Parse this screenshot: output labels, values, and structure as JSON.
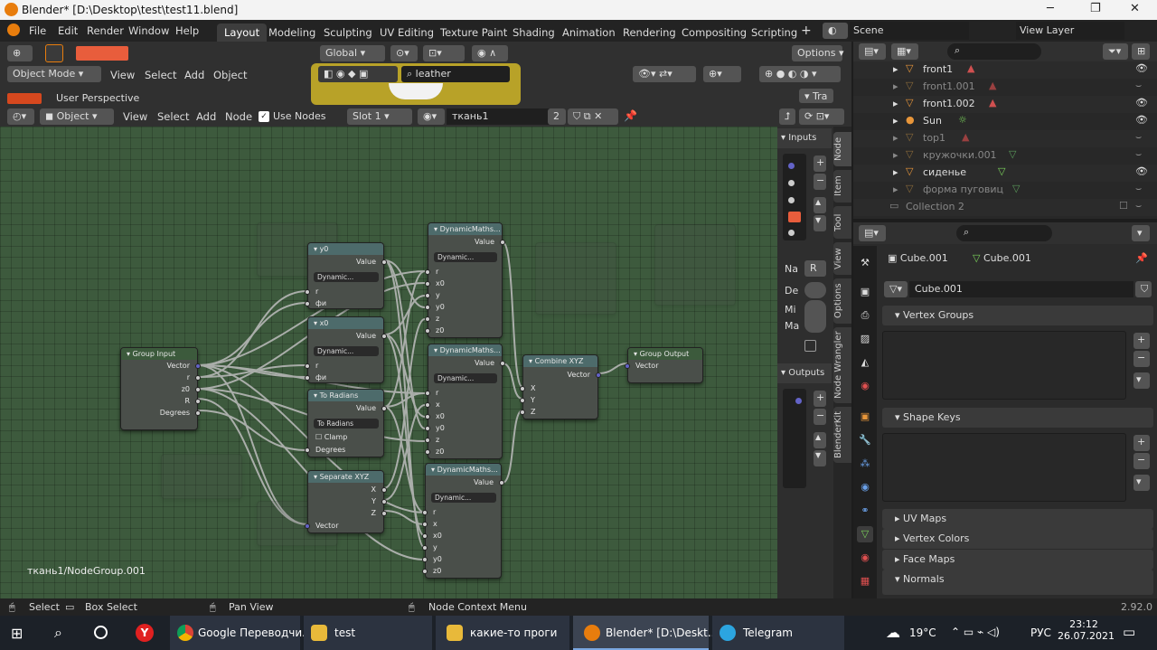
{
  "window": {
    "title": "Blender* [D:\\Desktop\\test\\test11.blend]"
  },
  "menus": [
    "File",
    "Edit",
    "Render",
    "Window",
    "Help"
  ],
  "workspaces": [
    "Layout",
    "Modeling",
    "Sculpting",
    "UV Editing",
    "Texture Paint",
    "Shading",
    "Animation",
    "Rendering",
    "Compositing",
    "Scripting"
  ],
  "topright": {
    "scene": "Scene",
    "viewlayer": "View Layer"
  },
  "viewport": {
    "transform": "Global",
    "options": "Options",
    "mode": "Object Mode",
    "view": "View",
    "select": "Select",
    "add": "Add",
    "object": "Object",
    "perspective": "User Perspective",
    "material_search": "leather",
    "tab_label": "Tra"
  },
  "node_header": {
    "type": "Object",
    "view": "View",
    "select": "Select",
    "add": "Add",
    "node": "Node",
    "use_nodes": "Use Nodes",
    "slot": "Slot 1",
    "material": "ткань1",
    "users": "2"
  },
  "breadcrumb": "ткань1/NodeGroup.001",
  "nodes": {
    "group_input": {
      "title": "Group Input",
      "sockets": [
        "Vector",
        "r",
        "z0",
        "R",
        "Degrees"
      ]
    },
    "y0": {
      "title": "y0",
      "out": "Value",
      "dd": "Dynamic...",
      "ins": [
        "r",
        "фи"
      ]
    },
    "x0": {
      "title": "x0",
      "out": "Value",
      "dd": "Dynamic...",
      "ins": [
        "r",
        "фи"
      ]
    },
    "to_radians": {
      "title": "To Radians",
      "out": "Value",
      "dd": "To Radians",
      "clamp": "Clamp",
      "in": "Degrees"
    },
    "separate": {
      "title": "Separate XYZ",
      "outs": [
        "X",
        "Y",
        "Z"
      ],
      "in": "Vector"
    },
    "dm1": {
      "title": "DynamicMaths...",
      "out": "Value",
      "dd": "Dynamic...",
      "ins": [
        "r",
        "x0",
        "y",
        "y0",
        "z",
        "z0"
      ]
    },
    "dm2": {
      "title": "DynamicMaths...",
      "out": "Value",
      "dd": "Dynamic...",
      "ins": [
        "r",
        "x",
        "x0",
        "y0",
        "z",
        "z0"
      ]
    },
    "dm3": {
      "title": "DynamicMaths...",
      "out": "Value",
      "dd": "Dynamic...",
      "ins": [
        "r",
        "x",
        "x0",
        "y",
        "y0",
        "z0"
      ]
    },
    "combine": {
      "title": "Combine XYZ",
      "out": "Vector",
      "ins": [
        "X",
        "Y",
        "Z"
      ]
    },
    "group_output": {
      "title": "Group Output",
      "in": "Vector"
    }
  },
  "side_panel": {
    "inputs": "Inputs",
    "outputs": "Outputs",
    "labels": [
      "Na",
      "De",
      "Mi",
      "Ma"
    ],
    "r": "R"
  },
  "side_tabs": [
    "Node",
    "Item",
    "Tool",
    "View",
    "Options",
    "Node Wrangler",
    "BlenderKit"
  ],
  "outliner": [
    {
      "name": "front1",
      "dim": false
    },
    {
      "name": "front1.001",
      "dim": true
    },
    {
      "name": "front1.002",
      "dim": false
    },
    {
      "name": "Sun",
      "dim": false
    },
    {
      "name": "top1",
      "dim": true
    },
    {
      "name": "кружочки.001",
      "dim": true
    },
    {
      "name": "сиденье",
      "dim": false
    },
    {
      "name": "форма пуговиц",
      "dim": true
    },
    {
      "name": "Collection 2",
      "dim": true
    }
  ],
  "properties": {
    "object": "Cube.001",
    "data": "Cube.001",
    "mesh": "Cube.001",
    "sections": [
      "Vertex Groups",
      "Shape Keys",
      "UV Maps",
      "Vertex Colors",
      "Face Maps",
      "Normals"
    ]
  },
  "statusbar": {
    "select": "Select",
    "box": "Box Select",
    "pan": "Pan View",
    "ctx": "Node Context Menu",
    "version": "2.92.0"
  },
  "taskbar": {
    "apps": [
      "Google Переводчи...",
      "test",
      "какие-то проги",
      "Blender* [D:\\Deskt...",
      "Telegram"
    ],
    "temp": "19°C",
    "lang": "РУС",
    "time": "23:12",
    "date": "26.07.2021"
  },
  "colors": {
    "accent": "#e87d0d",
    "grid": "#3d5a3d",
    "node_header": "#4d6b6b",
    "vector_socket": "#6363c7"
  }
}
